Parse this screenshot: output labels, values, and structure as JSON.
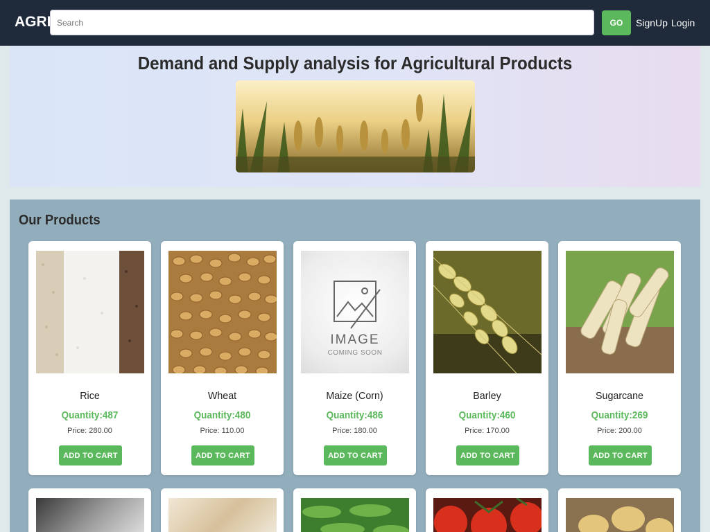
{
  "navbar": {
    "brand": "AGRI",
    "search_placeholder": "Search",
    "search_value": "",
    "go_label": "GO",
    "signup_label": "SignUp",
    "login_label": "Login",
    "bg_color": "#1f2a3b",
    "accent_color": "#5cb85c"
  },
  "hero": {
    "title": "Demand and Supply analysis for Agricultural Products",
    "image_icon": "wheat-field-photo"
  },
  "products": {
    "section_title": "Our Products",
    "cart_label": "ADD TO CART",
    "items": [
      {
        "name": "Rice",
        "quantity": "Quantity:487",
        "price": "Price: 280.00",
        "image": "rice-grains-photo"
      },
      {
        "name": "Wheat",
        "quantity": "Quantity:480",
        "price": "Price: 110.00",
        "image": "wheat-grains-photo"
      },
      {
        "name": "Maize (Corn)",
        "quantity": "Quantity:486",
        "price": "Price: 180.00",
        "image": "image-coming-soon-placeholder"
      },
      {
        "name": "Barley",
        "quantity": "Quantity:460",
        "price": "Price: 170.00",
        "image": "barley-ears-photo"
      },
      {
        "name": "Sugarcane",
        "quantity": "Quantity:269",
        "price": "Price: 200.00",
        "image": "sugarcane-stalks-photo"
      }
    ],
    "row2_images": [
      "cotton-photo",
      "sack-photo",
      "green-beans-photo",
      "tomatoes-photo",
      "potatoes-photo"
    ]
  },
  "placeholder_text": {
    "line1": "IMAGE",
    "line2": "COMING SOON"
  }
}
